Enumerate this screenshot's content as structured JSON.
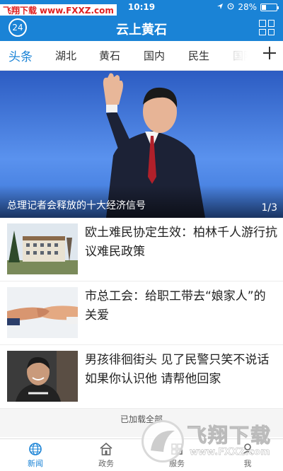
{
  "status_bar": {
    "time": "10:19",
    "battery": "28%",
    "battery_level": 0.28
  },
  "watermark_top": {
    "site": "飞翔下载",
    "url": "www.FXXZ.com"
  },
  "header": {
    "title": "云上黄石",
    "badge": "24",
    "menu_icon": "grid-icon"
  },
  "tabs": [
    {
      "label": "头条",
      "active": true
    },
    {
      "label": "湖北"
    },
    {
      "label": "黄石"
    },
    {
      "label": "国内"
    },
    {
      "label": "民生"
    },
    {
      "label": "国际"
    }
  ],
  "add_tab_icon": "plus-icon",
  "hero": {
    "caption": "总理记者会释放的十大经济信号",
    "pager": "1/3"
  },
  "news": [
    {
      "headline": "欧土难民协定生效：柏林千人游行抗议难民政策",
      "thumb": "buildings-photo"
    },
    {
      "headline": "市总工会：给职工带去“娘家人”的关爱",
      "thumb": "handshake-photo"
    },
    {
      "headline": "男孩徘徊街头 见了民警只笑不说话 如果你认识他 请帮他回家",
      "thumb": "boy-photo"
    }
  ],
  "list_footer": "已加载全部",
  "bottom_nav": [
    {
      "label": "新闻",
      "icon": "globe-icon",
      "active": true
    },
    {
      "label": "政务",
      "icon": "government-icon"
    },
    {
      "label": "服务",
      "icon": "service-icon"
    },
    {
      "label": "我",
      "icon": "user-icon"
    }
  ],
  "watermark_bottom": {
    "brand": "飞翔下载",
    "url": "www.FXXZ.com"
  },
  "colors": {
    "primary": "#1a83d6",
    "text": "#222222",
    "watermark": "#e02020"
  }
}
